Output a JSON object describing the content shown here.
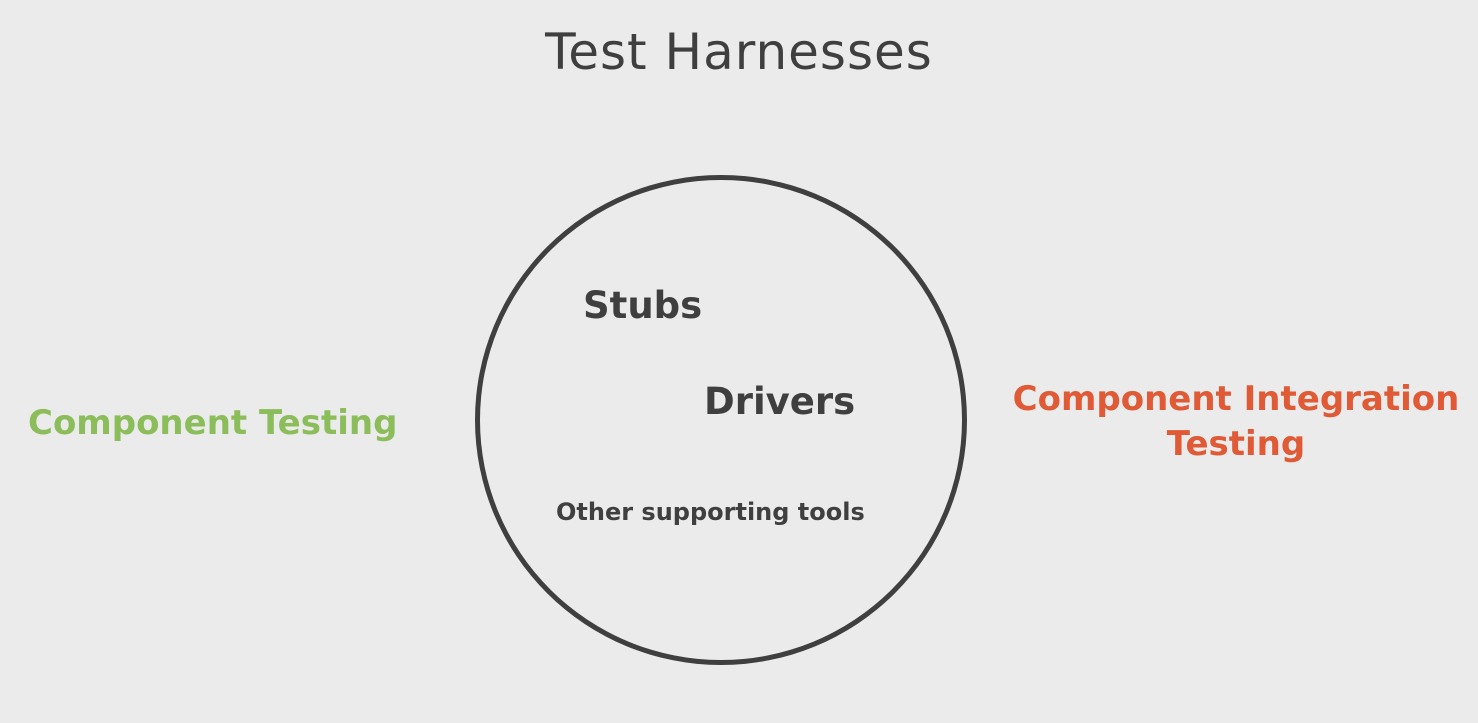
{
  "title": "Test Harnesses",
  "circle": {
    "items": [
      "Stubs",
      "Drivers",
      "Other supporting tools"
    ]
  },
  "left": {
    "label": "Component Testing",
    "color": "#8bbd5a"
  },
  "right": {
    "label_lines": [
      "Component Integration",
      "Testing"
    ],
    "color": "#df5a35"
  },
  "colors": {
    "background": "#ebebeb",
    "text": "#3f3f3f"
  }
}
